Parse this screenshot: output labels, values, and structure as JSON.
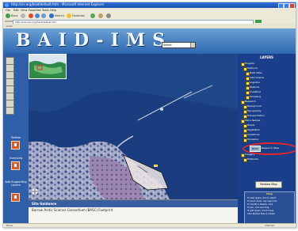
{
  "browser": {
    "title": "http://sis.org/baid/default.htm - Microsoft Internet Explorer",
    "menu": [
      "File",
      "Edit",
      "View",
      "Favorites",
      "Tools",
      "Help"
    ],
    "toolbar": {
      "back_label": "Back",
      "search_label": "Search",
      "favorites_label": "Favorites"
    },
    "address_label": "Address",
    "address_value": "http://baid.sis.org/baid/default.htm",
    "go_label": "Go",
    "links_label": "Links",
    "status_text": "Done",
    "zone_text": "Internet"
  },
  "app": {
    "logo": "BAID-IMS",
    "zoom_select": "Select"
  },
  "left_tools": {
    "labels": [
      "Toolbar",
      "Overview",
      "Add Supporting Layers"
    ]
  },
  "map": {
    "inset_alt": "overview map"
  },
  "info": {
    "header": "Site Guidance",
    "text": "Barrow Arctic Science Consortium (BASC) Footprint"
  },
  "layers": {
    "header": "LAYERS",
    "items": [
      "Projects",
      "Features",
      "BAID Sites",
      "Instruments",
      "Logistics",
      "Stations",
      "Coastline",
      "Sampling",
      "Research",
      "Background",
      "Topography",
      "Transportation",
      "Place Names",
      "Roads",
      "Vegetation",
      "Coastlines",
      "Shoreline",
      "Imagery",
      "Hillshade"
    ],
    "highlight_badge": "BASC",
    "highlight_label": "Research Sites",
    "redraw_label": "Redraw Map"
  },
  "help": {
    "header": "Help",
    "lines": [
      "To view layers, click to select",
      "To zoom in/out, use map tools",
      "To identify a feature, click",
      "To pan, click and drag",
      "To add layers, check boxes",
      "Click Redraw Map to refresh"
    ]
  },
  "colors": {
    "banner": "#2d67b0",
    "highlight_oval": "#e8272b",
    "sidebar_bg": "#1b3e8a"
  }
}
